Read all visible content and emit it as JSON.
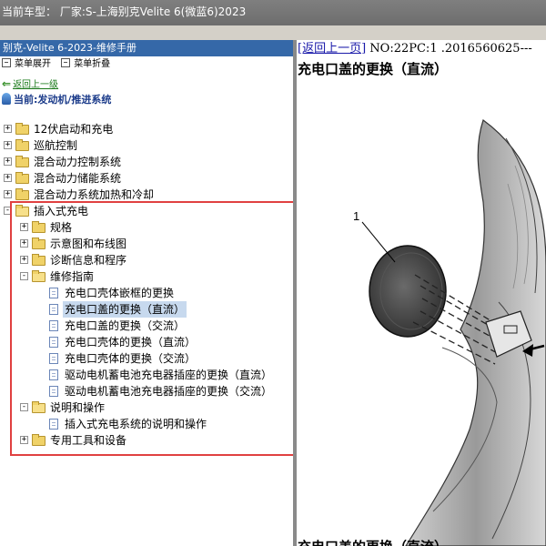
{
  "titlebar": {
    "text": "当前车型： 厂家:S-上海别克Velite 6(微蓝6)2023"
  },
  "left_panel": {
    "header": "别克-Velite 6-2023-维修手册",
    "toolbar": {
      "expand_label": "菜单展开",
      "collapse_label": "菜单折叠"
    },
    "back_label": "返回上一级",
    "current_label": "当前:发动机/推进系统"
  },
  "tree": [
    {
      "label": "12伏启动和充电",
      "level": 0,
      "type": "folder",
      "expander": "+"
    },
    {
      "label": "巡航控制",
      "level": 0,
      "type": "folder",
      "expander": "+"
    },
    {
      "label": "混合动力控制系统",
      "level": 0,
      "type": "folder",
      "expander": "+"
    },
    {
      "label": "混合动力储能系统",
      "level": 0,
      "type": "folder",
      "expander": "+"
    },
    {
      "label": "混合动力系统加热和冷却",
      "level": 0,
      "type": "folder",
      "expander": "+"
    },
    {
      "label": "插入式充电",
      "level": 0,
      "type": "folder-open",
      "expander": "-"
    },
    {
      "label": "规格",
      "level": 1,
      "type": "folder",
      "expander": "+"
    },
    {
      "label": "示意图和布线图",
      "level": 1,
      "type": "folder",
      "expander": "+"
    },
    {
      "label": "诊断信息和程序",
      "level": 1,
      "type": "folder",
      "expander": "+"
    },
    {
      "label": "维修指南",
      "level": 1,
      "type": "folder-open",
      "expander": "-"
    },
    {
      "label": "充电口壳体嵌框的更换",
      "level": 2,
      "type": "doc"
    },
    {
      "label": "充电口盖的更换（直流）",
      "level": 2,
      "type": "doc",
      "selected": true
    },
    {
      "label": "充电口盖的更换（交流）",
      "level": 2,
      "type": "doc"
    },
    {
      "label": "充电口壳体的更换（直流）",
      "level": 2,
      "type": "doc"
    },
    {
      "label": "充电口壳体的更换（交流）",
      "level": 2,
      "type": "doc"
    },
    {
      "label": "驱动电机蓄电池充电器插座的更换（直流）",
      "level": 2,
      "type": "doc"
    },
    {
      "label": "驱动电机蓄电池充电器插座的更换（交流）",
      "level": 2,
      "type": "doc"
    },
    {
      "label": "说明和操作",
      "level": 1,
      "type": "folder-open",
      "expander": "-"
    },
    {
      "label": "插入式充电系统的说明和操作",
      "level": 2,
      "type": "doc"
    },
    {
      "label": "专用工具和设备",
      "level": 1,
      "type": "folder",
      "expander": "+"
    }
  ],
  "content": {
    "back_link": "[返回上一页]",
    "doc_no": " NO:22PC:1 .2016560625---",
    "title": "充电口盖的更换（直流）",
    "callout": "1",
    "bottom_title": "充电口盖的更换（直流）"
  },
  "colors": {
    "highlight_box": "#e04040",
    "header_bg": "#3568a8",
    "link": "#1a1aaa"
  }
}
